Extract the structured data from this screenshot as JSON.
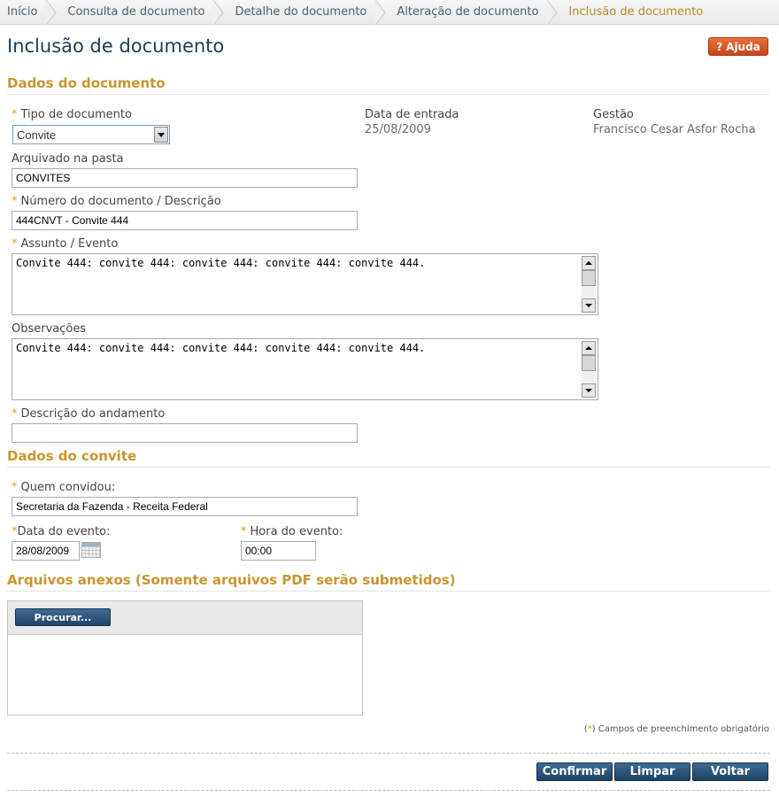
{
  "breadcrumb": [
    "Início",
    "Consulta de documento",
    "Detalhe do documento",
    "Alteração de documento",
    "Inclusão de documento"
  ],
  "page_title": "Inclusão de documento",
  "help_label": "Ajuda",
  "required_mark": "*",
  "section_document": "Dados do documento",
  "document": {
    "type_label": "Tipo de documento",
    "type_value": "Convite",
    "entry_date_label": "Data de entrada",
    "entry_date_value": "25/08/2009",
    "gestao_label": "Gestão",
    "gestao_value": "Francisco Cesar Asfor Rocha",
    "folder_label": "Arquivado na pasta",
    "folder_value": "CONVITES",
    "number_label": "Número do documento / Descrição",
    "number_value": "444CNVT - Convite 444",
    "subject_label": "Assunto / Evento",
    "subject_value": "Convite 444: convite 444: convite 444: convite 444: convite 444.",
    "notes_label": "Observações",
    "notes_value": "Convite 444: convite 444: convite 444: convite 444: convite 444.",
    "progress_label": "Descrição do andamento",
    "progress_value": ""
  },
  "section_invite": "Dados do convite",
  "invite": {
    "who_label": "Quem convidou:",
    "who_value": "Secretaria da Fazenda - Receita Federal",
    "date_label": "Data do evento:",
    "date_value": "28/08/2009",
    "time_label": "Hora do evento:",
    "time_value": "00:00"
  },
  "section_attachments": "Arquivos anexos (Somente arquivos PDF serão submetidos)",
  "browse_label": "Procurar...",
  "required_note": "Campos de preenchimento obrigatório",
  "buttons": {
    "confirm": "Confirmar",
    "clear": "Limpar",
    "back": "Voltar"
  },
  "colors": {
    "accent": "#c9962e",
    "title": "#1e3c57",
    "button": "#2a5379",
    "help": "#d4552a"
  }
}
